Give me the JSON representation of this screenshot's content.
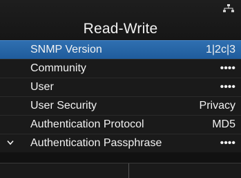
{
  "header": {
    "title": "Read-Write",
    "status_icon": "network-icon"
  },
  "menu": {
    "items": [
      {
        "label": "SNMP Version",
        "value": "1|2c|3",
        "selected": true
      },
      {
        "label": "Community",
        "value": "••••"
      },
      {
        "label": "User",
        "value": "••••"
      },
      {
        "label": "User Security",
        "value": "Privacy"
      },
      {
        "label": "Authentication Protocol",
        "value": "MD5"
      },
      {
        "label": "Authentication Passphrase",
        "value": "••••",
        "chevron": "chevron-down-icon"
      }
    ]
  },
  "colors": {
    "selected_row": "#2a6aa8",
    "background": "#111111",
    "text": "#f2f2f2"
  }
}
